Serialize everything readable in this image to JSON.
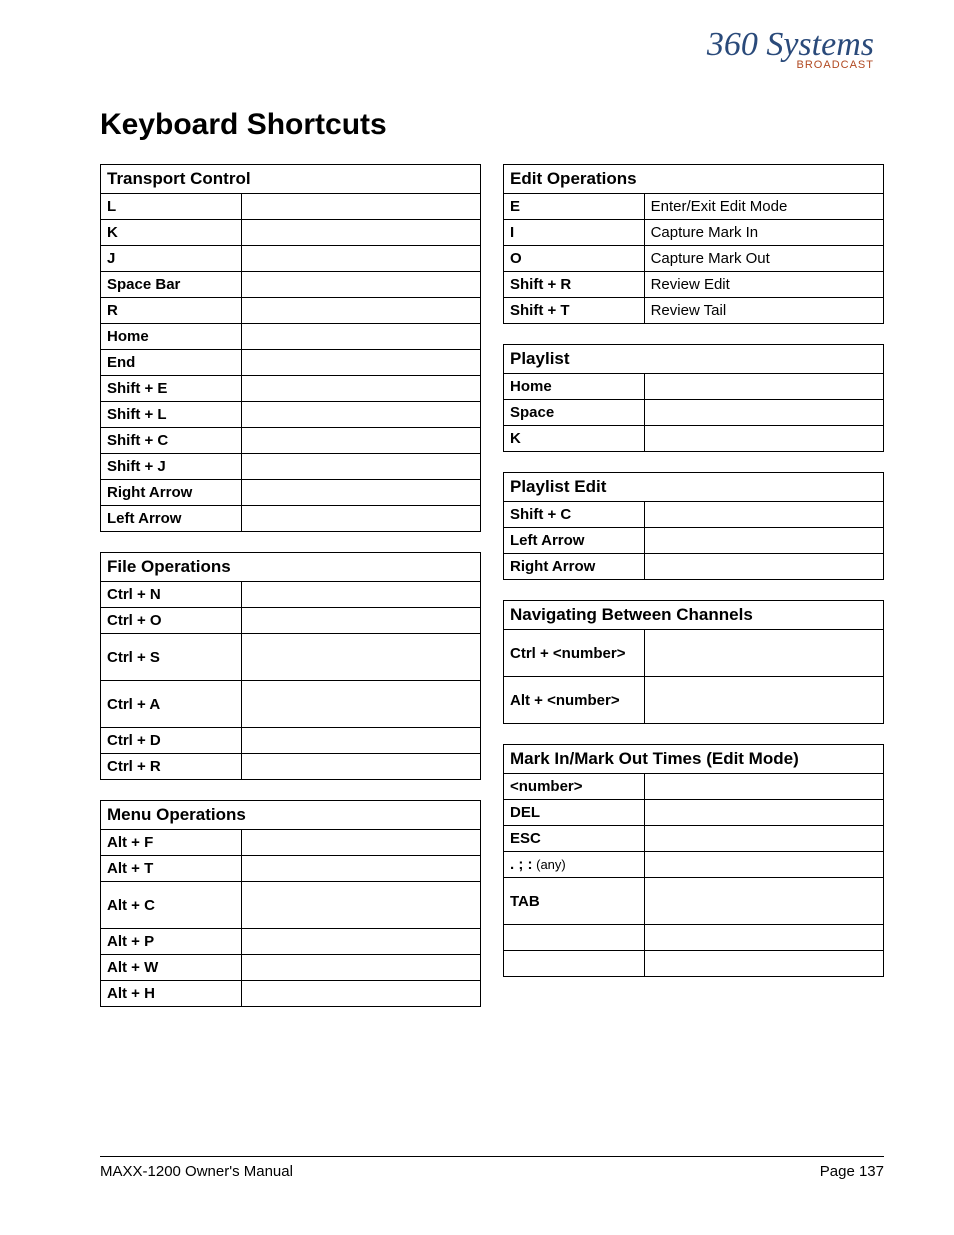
{
  "logo": {
    "main": "360 Systems",
    "sub": "BROADCAST"
  },
  "title": "Keyboard Shortcuts",
  "left_sections": [
    {
      "header": "Transport Control",
      "rows": [
        {
          "key": "L",
          "desc": ""
        },
        {
          "key": "K",
          "desc": ""
        },
        {
          "key": "J",
          "desc": ""
        },
        {
          "key": "Space Bar",
          "desc": ""
        },
        {
          "key": "R",
          "desc": ""
        },
        {
          "key": "Home",
          "desc": ""
        },
        {
          "key": "End",
          "desc": ""
        },
        {
          "key": "Shift + E",
          "desc": ""
        },
        {
          "key": "Shift + L",
          "desc": ""
        },
        {
          "key": "Shift + C",
          "desc": ""
        },
        {
          "key": "Shift + J",
          "desc": ""
        },
        {
          "key": "Right Arrow",
          "desc": ""
        },
        {
          "key": "Left Arrow",
          "desc": ""
        }
      ]
    },
    {
      "header": "File Operations",
      "rows": [
        {
          "key": "Ctrl + N",
          "desc": ""
        },
        {
          "key": "Ctrl + O",
          "desc": ""
        },
        {
          "key": "Ctrl + S",
          "desc": "",
          "tall": true
        },
        {
          "key": "Ctrl + A",
          "desc": "",
          "tall": true
        },
        {
          "key": "Ctrl + D",
          "desc": ""
        },
        {
          "key": "Ctrl + R",
          "desc": ""
        }
      ]
    },
    {
      "header": "Menu Operations",
      "rows": [
        {
          "key": "Alt + F",
          "desc": ""
        },
        {
          "key": "Alt + T",
          "desc": ""
        },
        {
          "key": "Alt + C",
          "desc": "",
          "tall": true
        },
        {
          "key": "Alt + P",
          "desc": ""
        },
        {
          "key": "Alt + W",
          "desc": ""
        },
        {
          "key": "Alt + H",
          "desc": ""
        }
      ]
    }
  ],
  "right_sections": [
    {
      "header": "Edit Operations",
      "rows": [
        {
          "key": "E",
          "desc": "Enter/Exit Edit Mode"
        },
        {
          "key": "I",
          "desc": "Capture Mark In"
        },
        {
          "key": "O",
          "desc": "Capture Mark Out"
        },
        {
          "key": "Shift + R",
          "desc": "Review Edit"
        },
        {
          "key": "Shift + T",
          "desc": "Review Tail"
        }
      ]
    },
    {
      "header": "Playlist",
      "rows": [
        {
          "key": "Home",
          "desc": ""
        },
        {
          "key": "Space",
          "desc": ""
        },
        {
          "key": "K",
          "desc": ""
        }
      ]
    },
    {
      "header": "Playlist Edit",
      "rows": [
        {
          "key": "Shift + C",
          "desc": ""
        },
        {
          "key": "Left Arrow",
          "desc": ""
        },
        {
          "key": "Right Arrow",
          "desc": ""
        }
      ]
    },
    {
      "header": "Navigating Between Channels",
      "rows": [
        {
          "key": "Ctrl + <number>",
          "desc": "",
          "tall": true
        },
        {
          "key": "Alt + <number>",
          "desc": "",
          "tall": true
        }
      ]
    },
    {
      "header": "Mark In/Mark Out Times (Edit Mode)",
      "rows": [
        {
          "key": "<number>",
          "desc": ""
        },
        {
          "key": "DEL",
          "desc": ""
        },
        {
          "key": "ESC",
          "desc": ""
        },
        {
          "key": ".  ;  :",
          "any": "(any)",
          "desc": ""
        },
        {
          "key": "TAB",
          "desc": "",
          "tall": true
        },
        {
          "key": "",
          "desc": ""
        },
        {
          "key": "",
          "desc": ""
        }
      ]
    }
  ],
  "footer": {
    "left": "MAXX-1200 Owner's Manual",
    "right": "Page 137"
  }
}
